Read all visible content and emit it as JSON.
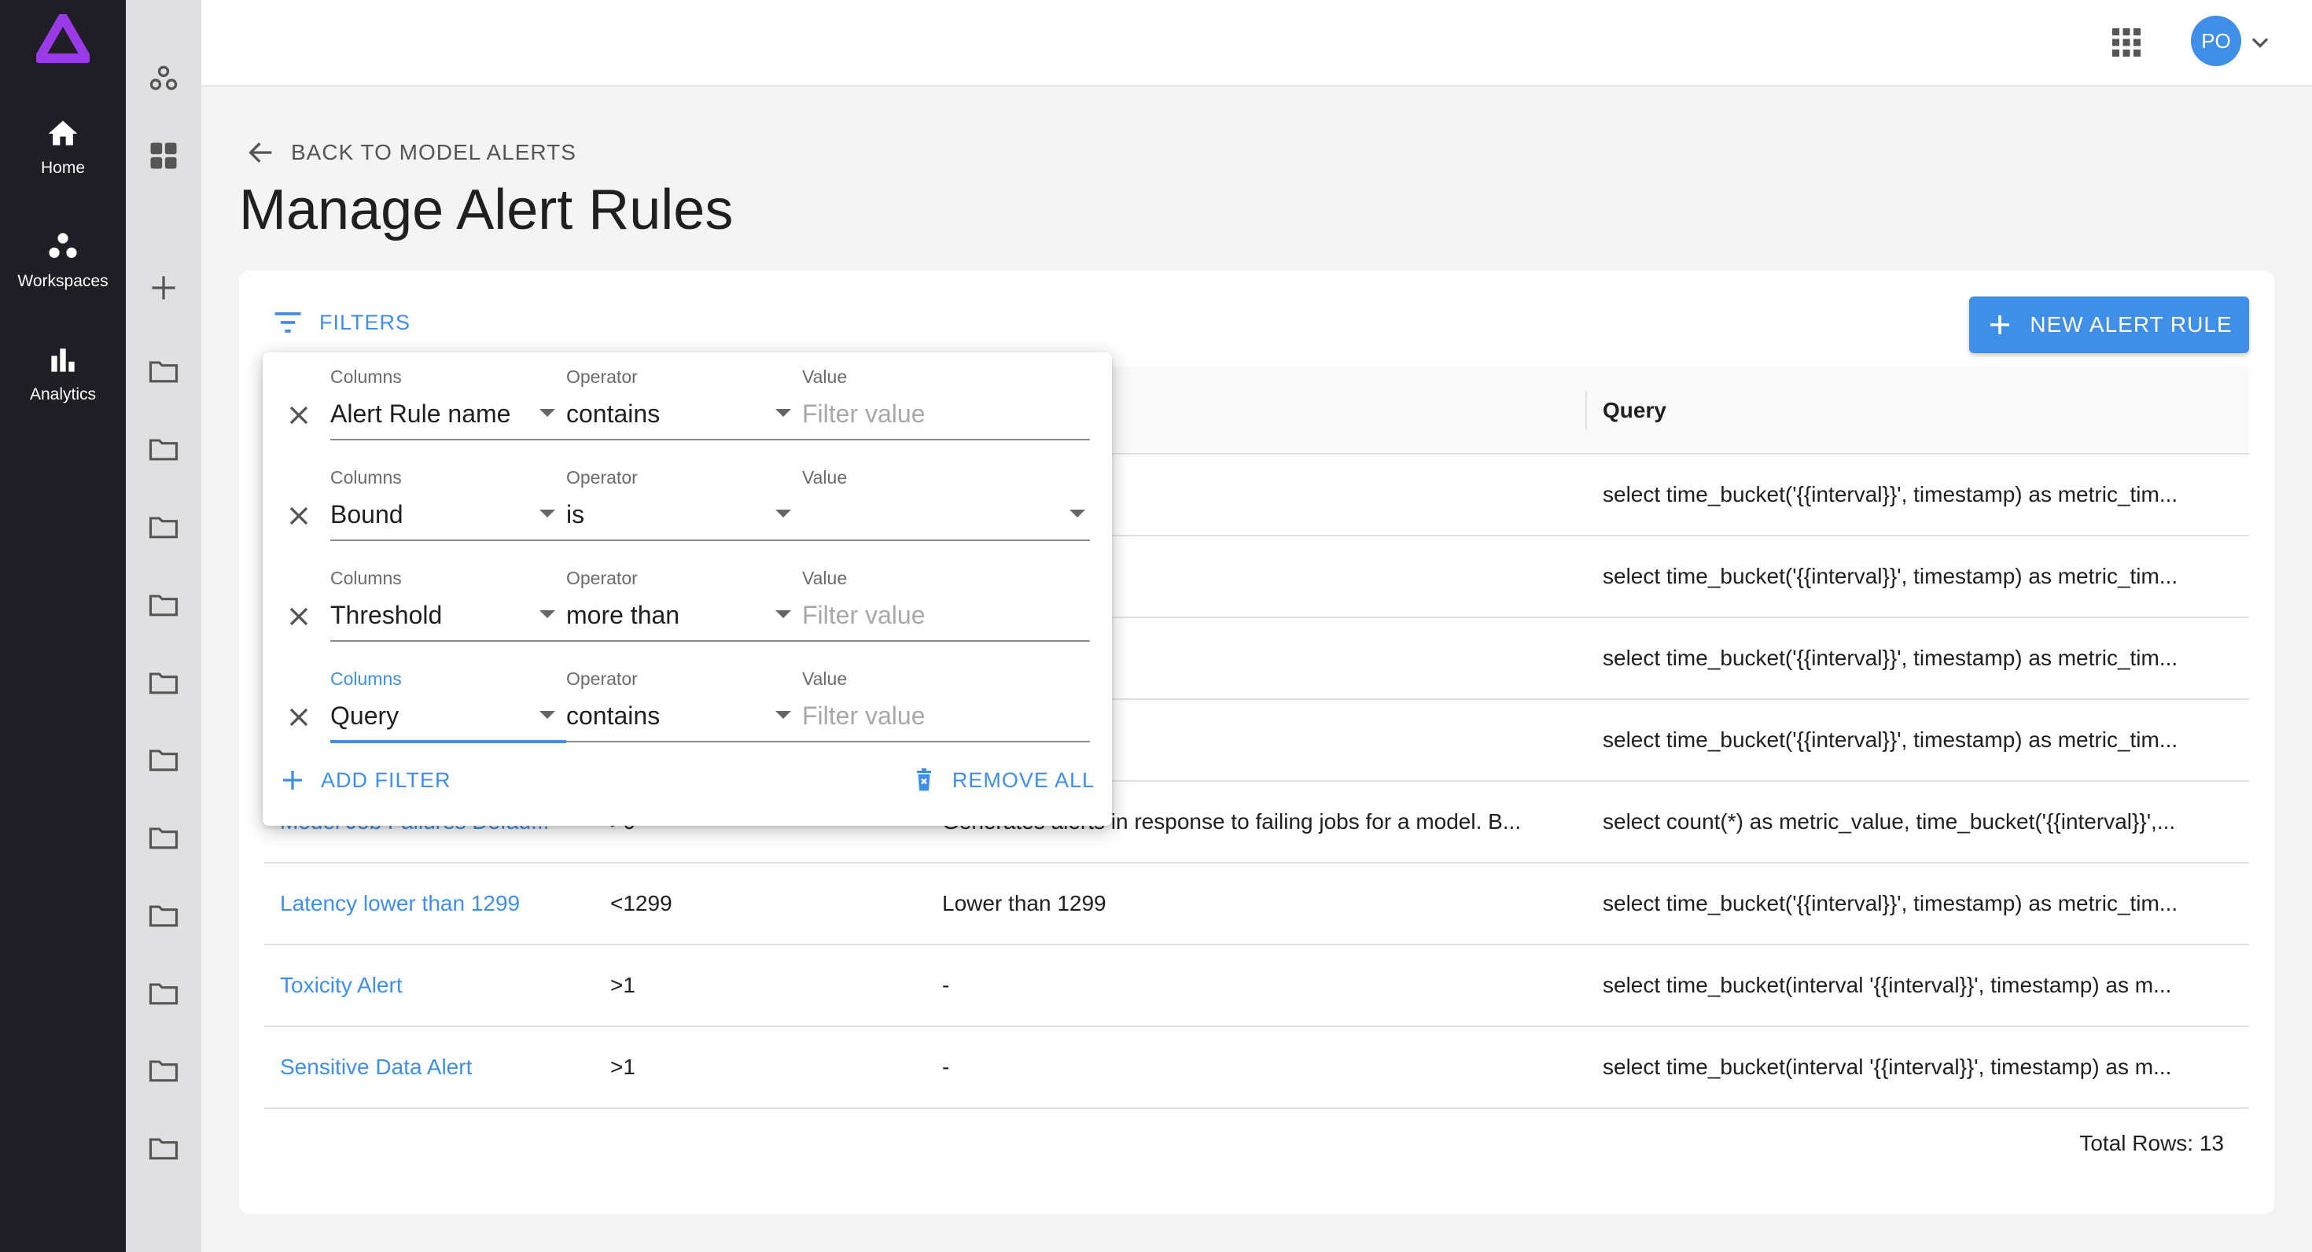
{
  "sidebar": {
    "items": [
      {
        "label": "Home",
        "icon": "home-icon"
      },
      {
        "label": "Workspaces",
        "icon": "workspaces-icon"
      },
      {
        "label": "Analytics",
        "icon": "analytics-icon"
      }
    ]
  },
  "topbar": {
    "avatar_initials": "PO"
  },
  "header": {
    "back_label": "BACK TO MODEL ALERTS",
    "title": "Manage Alert Rules"
  },
  "toolbar": {
    "filters_label": "FILTERS",
    "new_rule_label": "NEW ALERT RULE"
  },
  "table": {
    "columns": [
      "Query"
    ],
    "rows": [
      {
        "name": "",
        "bound": "",
        "description": "",
        "query": "select time_bucket('{{interval}}', timestamp) as metric_tim..."
      },
      {
        "name": "",
        "bound": "",
        "description": "",
        "query": "select time_bucket('{{interval}}', timestamp) as metric_tim..."
      },
      {
        "name": "",
        "bound": "",
        "description": "",
        "query": "select time_bucket('{{interval}}', timestamp) as metric_tim..."
      },
      {
        "name": "",
        "bound": "",
        "description": "",
        "query": "select time_bucket('{{interval}}', timestamp) as metric_tim..."
      },
      {
        "name": "Model Job Failures Defau...",
        "bound": ">0",
        "description": "Generates alerts in response to failing jobs for a model. B...",
        "query": "select count(*) as metric_value, time_bucket('{{interval}}',..."
      },
      {
        "name": "Latency lower than 1299",
        "bound": "<1299",
        "description": "Lower than 1299",
        "query": "select time_bucket('{{interval}}', timestamp) as metric_tim..."
      },
      {
        "name": "Toxicity Alert",
        "bound": ">1",
        "description": "-",
        "query": "select time_bucket(interval '{{interval}}', timestamp) as m..."
      },
      {
        "name": "Sensitive Data Alert",
        "bound": ">1",
        "description": "-",
        "query": "select time_bucket(interval '{{interval}}', timestamp) as m..."
      }
    ],
    "total_rows": "Total Rows: 13"
  },
  "filter_panel": {
    "column_label": "Columns",
    "operator_label": "Operator",
    "value_label": "Value",
    "filters": [
      {
        "column": "Alert Rule name",
        "operator": "contains",
        "value": "",
        "placeholder": "Filter value"
      },
      {
        "column": "Bound",
        "operator": "is",
        "value": "",
        "placeholder": ""
      },
      {
        "column": "Threshold",
        "operator": "more than",
        "value": "",
        "placeholder": "Filter value"
      },
      {
        "column": "Query",
        "operator": "contains",
        "value": "",
        "placeholder": "Filter value"
      }
    ],
    "add_filter_label": "ADD FILTER",
    "remove_all_label": "REMOVE ALL"
  },
  "colors": {
    "accent": "#3f8fe8",
    "sidebar_bg": "#1e1e24",
    "logo_purple": "#9b3ae8"
  }
}
